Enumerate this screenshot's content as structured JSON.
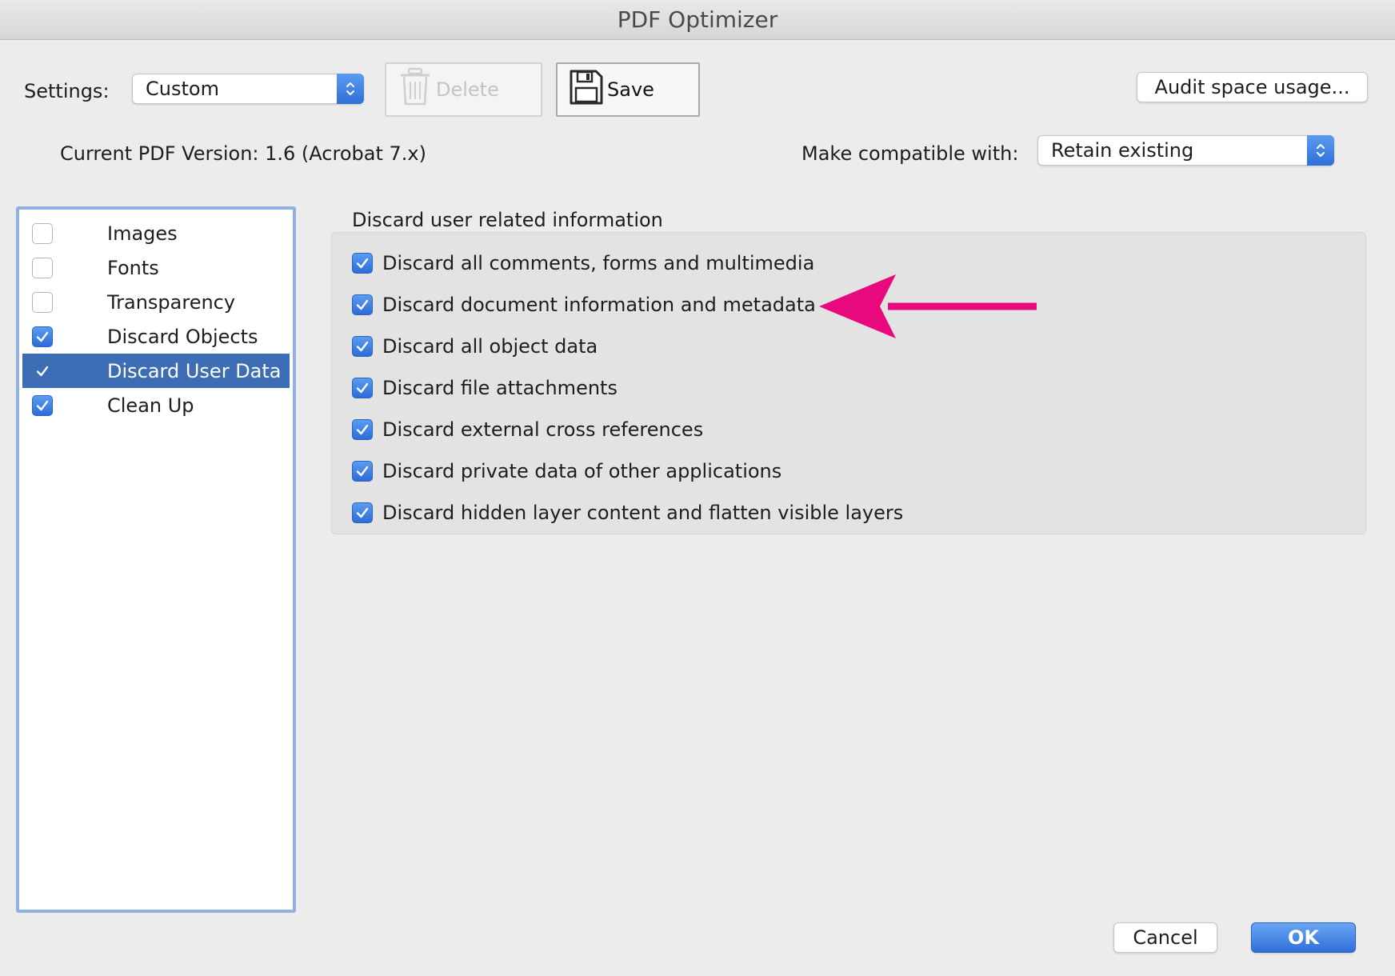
{
  "window": {
    "title": "PDF Optimizer"
  },
  "toolbar": {
    "settings_label": "Settings:",
    "settings_value": "Custom",
    "delete_label": "Delete",
    "save_label": "Save",
    "audit_label": "Audit space usage..."
  },
  "version": {
    "current_label": "Current PDF Version: 1.6 (Acrobat 7.x)",
    "compat_label": "Make compatible with:",
    "compat_value": "Retain existing"
  },
  "sidebar": {
    "items": [
      {
        "label": "Images",
        "checked": false,
        "selected": false
      },
      {
        "label": "Fonts",
        "checked": false,
        "selected": false
      },
      {
        "label": "Transparency",
        "checked": false,
        "selected": false
      },
      {
        "label": "Discard Objects",
        "checked": true,
        "selected": false
      },
      {
        "label": "Discard User Data",
        "checked": true,
        "selected": true
      },
      {
        "label": "Clean Up",
        "checked": true,
        "selected": false
      }
    ]
  },
  "panel": {
    "heading": "Discard user related information",
    "options": [
      {
        "label": "Discard all comments, forms and multimedia",
        "checked": true
      },
      {
        "label": "Discard document information and metadata",
        "checked": true
      },
      {
        "label": "Discard all object data",
        "checked": true
      },
      {
        "label": "Discard file attachments",
        "checked": true
      },
      {
        "label": "Discard external cross references",
        "checked": true
      },
      {
        "label": "Discard private data of other applications",
        "checked": true
      },
      {
        "label": "Discard hidden layer content and flatten visible layers",
        "checked": true
      }
    ]
  },
  "footer": {
    "cancel_label": "Cancel",
    "ok_label": "OK"
  },
  "colors": {
    "accent": "#2f6fd8",
    "selection": "#3c6db5",
    "annotation_arrow": "#e8097f"
  }
}
